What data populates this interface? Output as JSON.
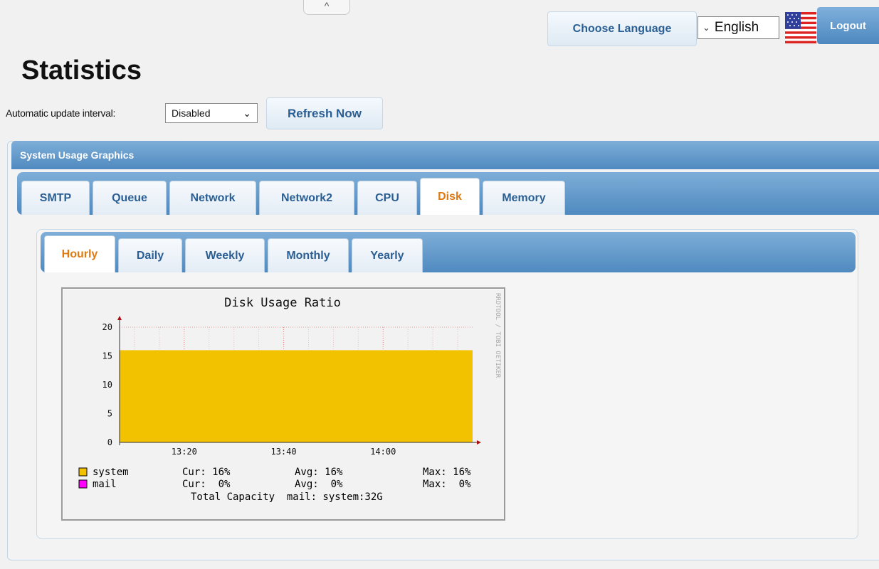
{
  "header": {
    "collapse_glyph": "^",
    "choose_language_label": "Choose Language",
    "language_selected": "English",
    "language_chevron": "⌄",
    "logout_label": "Logout"
  },
  "page": {
    "title": "Statistics",
    "auto_update_label": "Automatic update interval:",
    "interval_selected": "Disabled",
    "interval_chevron": "⌄",
    "refresh_label": "Refresh Now"
  },
  "panel": {
    "title": "System Usage Graphics",
    "main_tabs": [
      {
        "label": "SMTP",
        "active": false
      },
      {
        "label": "Queue",
        "active": false
      },
      {
        "label": "Network",
        "active": false
      },
      {
        "label": "Network2",
        "active": false
      },
      {
        "label": "CPU",
        "active": false
      },
      {
        "label": "Disk",
        "active": true
      },
      {
        "label": "Memory",
        "active": false
      }
    ],
    "sub_tabs": [
      {
        "label": "Hourly",
        "active": true
      },
      {
        "label": "Daily",
        "active": false
      },
      {
        "label": "Weekly",
        "active": false
      },
      {
        "label": "Monthly",
        "active": false
      },
      {
        "label": "Yearly",
        "active": false
      }
    ]
  },
  "colors": {
    "accent_blue": "#4f8ac0",
    "active_tab_text": "#e07a10",
    "system_series": "#f2c200",
    "mail_series": "#ff00ff"
  },
  "chart_data": {
    "type": "area",
    "title": "Disk Usage Ratio",
    "watermark": "RRDTOOL / TOBI OETIKER",
    "x_ticks": [
      "13:20",
      "13:40",
      "14:00"
    ],
    "y_ticks": [
      "0",
      "5",
      "10",
      "15",
      "20"
    ],
    "ylim": [
      0,
      20
    ],
    "x": [
      "13:07",
      "14:18"
    ],
    "series": [
      {
        "name": "system",
        "values": [
          16,
          16
        ]
      },
      {
        "name": "mail",
        "values": [
          0,
          0
        ]
      }
    ],
    "legend": [
      {
        "name": "system",
        "cur": "Cur: 16%",
        "avg": "Avg: 16%",
        "max": "Max: 16%"
      },
      {
        "name": "mail",
        "cur": "Cur:  0%",
        "avg": "Avg:  0%",
        "max": "Max:  0%"
      }
    ],
    "footer": "Total Capacity  mail: system:32G",
    "grid": true
  }
}
